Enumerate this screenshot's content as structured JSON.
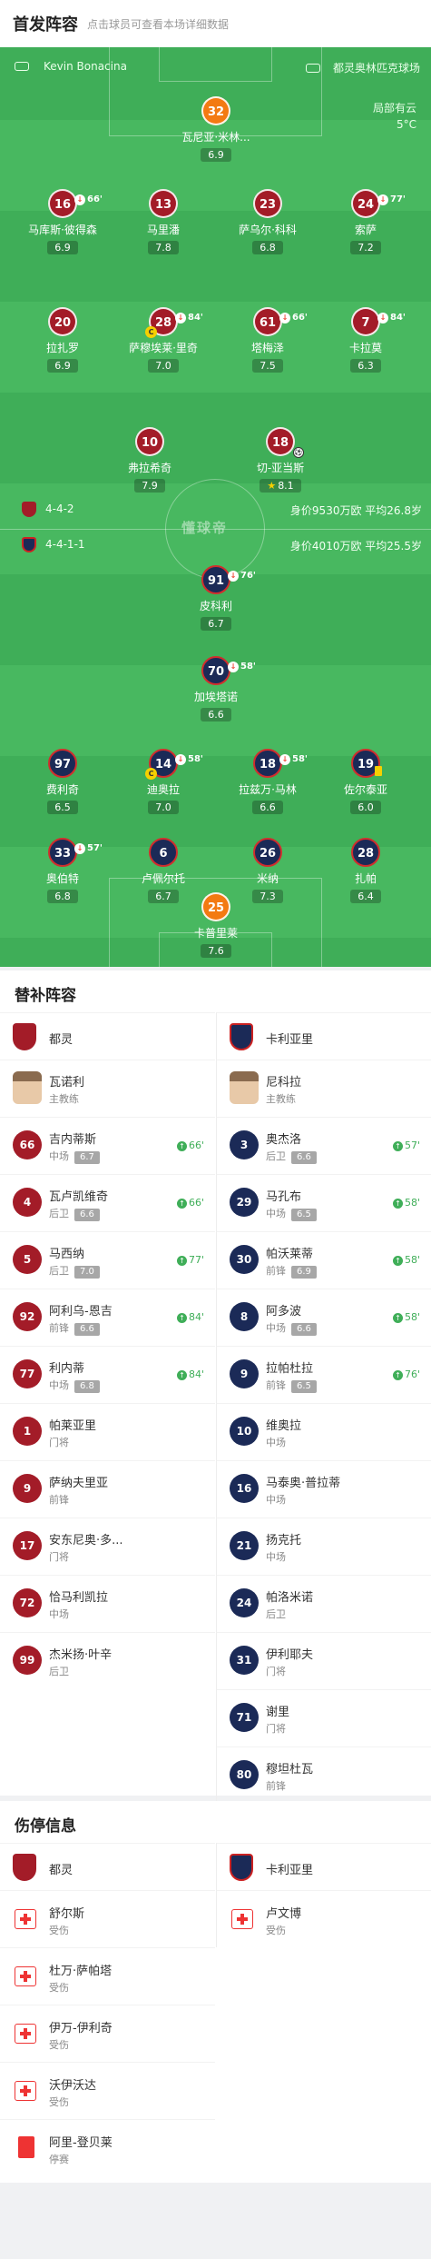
{
  "header": {
    "title": "首发阵容",
    "hint": "点击球员可查看本场详细数据"
  },
  "pitch": {
    "referee": "Kevin Bonacina",
    "stadium": "都灵奥林匹克球场",
    "weather": "局部有云",
    "temperature": "5°C",
    "watermark": "懂球帝",
    "home_info": {
      "formation": "4-4-2",
      "value": "身价9530万欧 平均26.8岁"
    },
    "away_info": {
      "formation": "4-4-1-1",
      "value": "身价4010万欧 平均25.5岁"
    }
  },
  "home_players": [
    {
      "num": "32",
      "name": "瓦尼亚·米林...",
      "rating": "6.9"
    },
    {
      "num": "16",
      "name": "马库斯·彼得森",
      "rating": "6.9",
      "sub": "66'"
    },
    {
      "num": "13",
      "name": "马里潘",
      "rating": "7.8"
    },
    {
      "num": "23",
      "name": "萨乌尔·科科",
      "rating": "6.8"
    },
    {
      "num": "24",
      "name": "索萨",
      "rating": "7.2",
      "sub": "77'"
    },
    {
      "num": "20",
      "name": "拉扎罗",
      "rating": "6.9"
    },
    {
      "num": "28",
      "name": "萨穆埃莱·里奇",
      "rating": "7.0",
      "sub": "84'"
    },
    {
      "num": "61",
      "name": "塔梅泽",
      "rating": "7.5",
      "sub": "66'"
    },
    {
      "num": "7",
      "name": "卡拉莫",
      "rating": "6.3",
      "sub": "84'"
    },
    {
      "num": "10",
      "name": "弗拉希奇",
      "rating": "7.9"
    },
    {
      "num": "18",
      "name": "切-亚当斯",
      "rating": "8.1"
    }
  ],
  "away_players": [
    {
      "num": "91",
      "name": "皮科利",
      "rating": "6.7",
      "sub": "76'"
    },
    {
      "num": "70",
      "name": "加埃塔诺",
      "rating": "6.6",
      "sub": "58'"
    },
    {
      "num": "97",
      "name": "费利奇",
      "rating": "6.5"
    },
    {
      "num": "14",
      "name": "迪奥拉",
      "rating": "7.0",
      "sub": "58'"
    },
    {
      "num": "18",
      "name": "拉兹万·马林",
      "rating": "6.6",
      "sub": "58'"
    },
    {
      "num": "19",
      "name": "佐尔泰亚",
      "rating": "6.0"
    },
    {
      "num": "33",
      "name": "奥伯特",
      "rating": "6.8",
      "sub": "57'"
    },
    {
      "num": "6",
      "name": "卢佩尔托",
      "rating": "6.7"
    },
    {
      "num": "26",
      "name": "米纳",
      "rating": "7.3"
    },
    {
      "num": "28",
      "name": "扎帕",
      "rating": "6.4"
    },
    {
      "num": "25",
      "name": "卡普里莱",
      "rating": "7.6"
    }
  ],
  "subs": {
    "title": "替补阵容",
    "home_team": "都灵",
    "away_team": "卡利亚里",
    "home_coach": {
      "name": "瓦诺利",
      "role": "主教练"
    },
    "away_coach": {
      "name": "尼科拉",
      "role": "主教练"
    },
    "home": [
      {
        "num": "66",
        "name": "吉内蒂斯",
        "pos": "中场",
        "rating": "6.7",
        "min": "66'"
      },
      {
        "num": "4",
        "name": "瓦卢凯维奇",
        "pos": "后卫",
        "rating": "6.6",
        "min": "66'"
      },
      {
        "num": "5",
        "name": "马西纳",
        "pos": "后卫",
        "rating": "7.0",
        "min": "77'"
      },
      {
        "num": "92",
        "name": "阿利乌-恩吉",
        "pos": "前锋",
        "rating": "6.6",
        "min": "84'"
      },
      {
        "num": "77",
        "name": "利内蒂",
        "pos": "中场",
        "rating": "6.8",
        "min": "84'"
      },
      {
        "num": "1",
        "name": "帕莱亚里",
        "pos": "门将"
      },
      {
        "num": "9",
        "name": "萨纳夫里亚",
        "pos": "前锋"
      },
      {
        "num": "17",
        "name": "安东尼奥·多...",
        "pos": "门将"
      },
      {
        "num": "72",
        "name": "恰马利凯拉",
        "pos": "中场"
      },
      {
        "num": "99",
        "name": "杰米扬·叶辛",
        "pos": "后卫"
      }
    ],
    "away": [
      {
        "num": "3",
        "name": "奥杰洛",
        "pos": "后卫",
        "rating": "6.6",
        "min": "57'"
      },
      {
        "num": "29",
        "name": "马孔布",
        "pos": "中场",
        "rating": "6.5",
        "min": "58'"
      },
      {
        "num": "30",
        "name": "帕沃莱蒂",
        "pos": "前锋",
        "rating": "6.9",
        "min": "58'"
      },
      {
        "num": "8",
        "name": "阿多波",
        "pos": "中场",
        "rating": "6.6",
        "min": "58'"
      },
      {
        "num": "9",
        "name": "拉帕杜拉",
        "pos": "前锋",
        "rating": "6.5",
        "min": "76'"
      },
      {
        "num": "10",
        "name": "维奥拉",
        "pos": "中场"
      },
      {
        "num": "16",
        "name": "马泰奥·普拉蒂",
        "pos": "中场"
      },
      {
        "num": "21",
        "name": "扬克托",
        "pos": "中场"
      },
      {
        "num": "24",
        "name": "帕洛米诺",
        "pos": "后卫"
      },
      {
        "num": "31",
        "name": "伊利耶夫",
        "pos": "门将"
      },
      {
        "num": "71",
        "name": "谢里",
        "pos": "门将"
      },
      {
        "num": "80",
        "name": "穆坦杜瓦",
        "pos": "前锋"
      }
    ]
  },
  "injuries": {
    "title": "伤停信息",
    "home_team": "都灵",
    "away_team": "卡利亚里",
    "home": [
      {
        "name": "舒尔斯",
        "status": "受伤",
        "type": "injury"
      },
      {
        "name": "杜万·萨帕塔",
        "status": "受伤",
        "type": "injury"
      },
      {
        "name": "伊万-伊利奇",
        "status": "受伤",
        "type": "injury"
      },
      {
        "name": "沃伊沃达",
        "status": "受伤",
        "type": "injury"
      },
      {
        "name": "阿里-登贝莱",
        "status": "停赛",
        "type": "suspension"
      }
    ],
    "away": [
      {
        "name": "卢文博",
        "status": "受伤",
        "type": "injury"
      }
    ]
  },
  "colors": {
    "home": "#a31c28",
    "away": "#1b2a57",
    "pitch": "#3fae58",
    "keeper": "#f37a12"
  }
}
